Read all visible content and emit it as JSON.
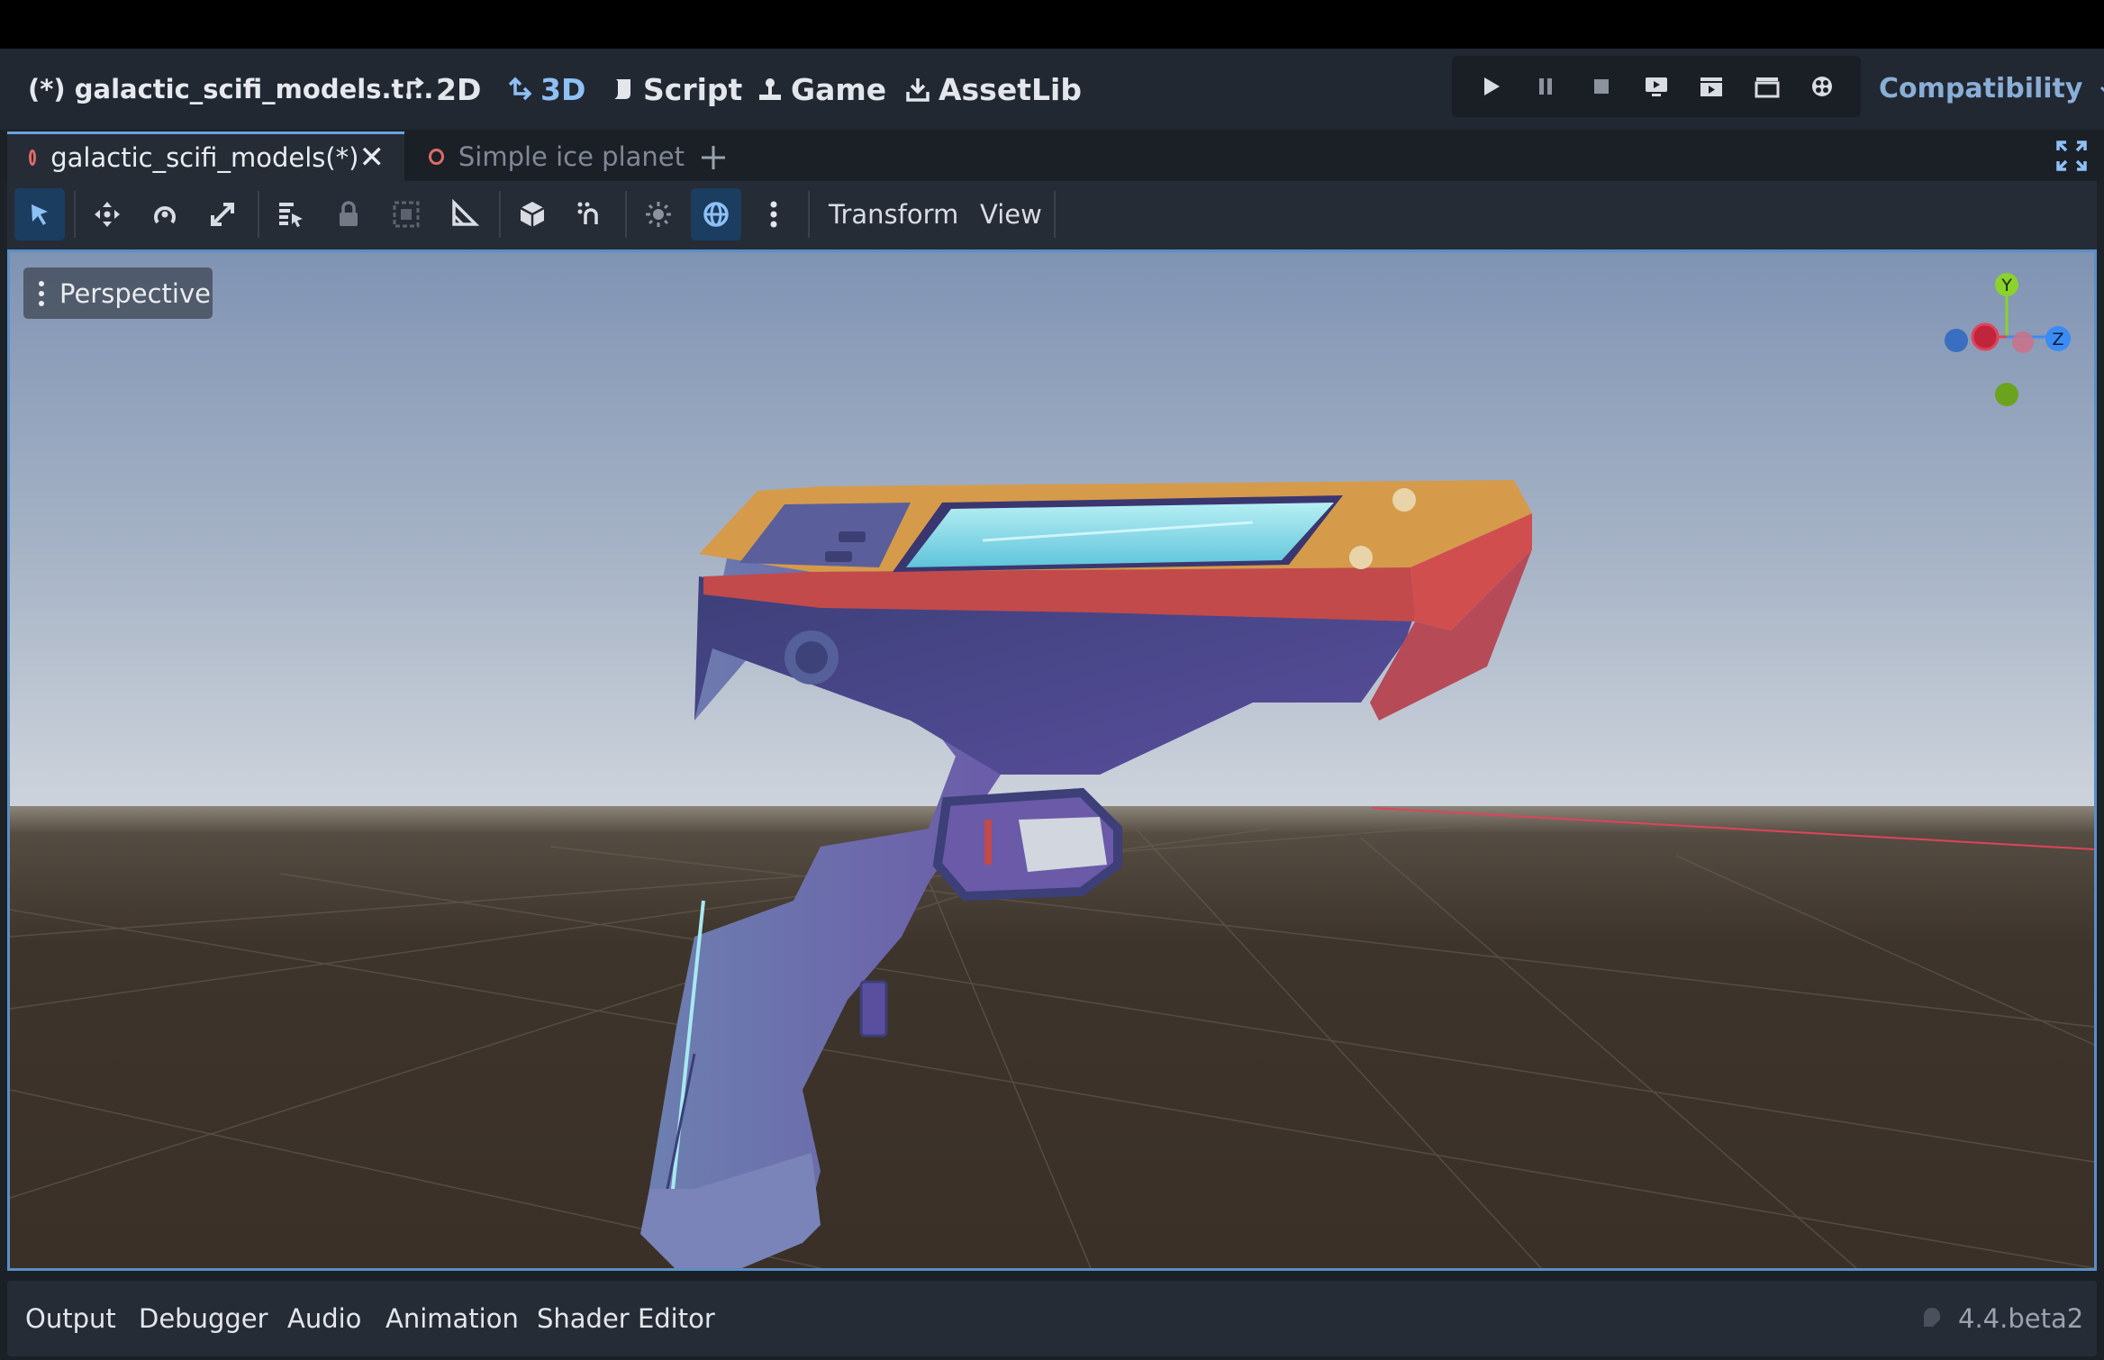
{
  "scene_title": "(*) galactic_scifi_models.t...",
  "workspaces": [
    {
      "label": "2D",
      "active": false,
      "icon": "2d-icon"
    },
    {
      "label": "3D",
      "active": true,
      "icon": "3d-icon"
    },
    {
      "label": "Script",
      "active": false,
      "icon": "script-icon"
    },
    {
      "label": "Game",
      "active": false,
      "icon": "game-icon"
    },
    {
      "label": "AssetLib",
      "active": false,
      "icon": "assetlib-icon"
    }
  ],
  "play_controls": [
    "play-icon",
    "pause-icon",
    "stop-icon",
    "remote-debug-icon",
    "play-scene-icon",
    "play-custom-scene-icon",
    "movie-maker-icon"
  ],
  "renderer": {
    "label": "Compatibility"
  },
  "tabs": [
    {
      "label": "galactic_scifi_models(*)",
      "active": true
    },
    {
      "label": "Simple ice planet",
      "active": false
    }
  ],
  "toolbar": {
    "icons": [
      "select-mode-icon",
      "move-mode-icon",
      "rotate-mode-icon",
      "scale-mode-icon",
      "list-select-icon",
      "lock-icon",
      "group-icon",
      "ruler-icon",
      "local-space-icon",
      "snap-icon",
      "sun-preview-icon",
      "environment-preview-icon",
      "more-icon"
    ],
    "menus": [
      "Transform",
      "View"
    ]
  },
  "viewport": {
    "view_label": "Perspective",
    "gizmo_axes": [
      "Y",
      "Z"
    ]
  },
  "bottom_tabs": [
    "Output",
    "Debugger",
    "Audio",
    "Animation",
    "Shader Editor"
  ],
  "version": "4.4.beta2",
  "colors": {
    "accent": "#8ec0f5",
    "tab_ring": "#e06b6b",
    "x_axis": "#e0435b",
    "y_axis": "#8ad22c",
    "z_axis": "#3a8cf5"
  }
}
